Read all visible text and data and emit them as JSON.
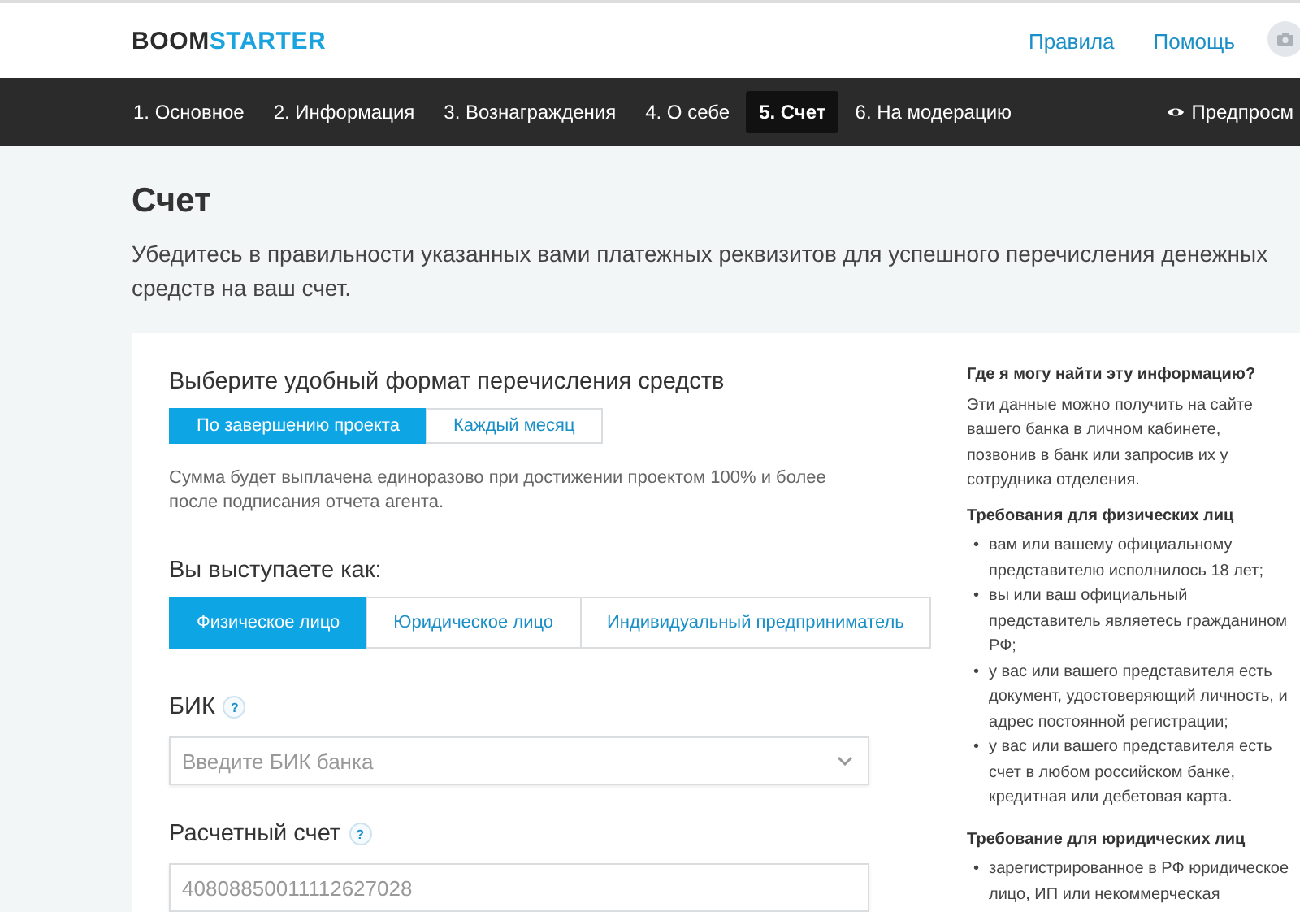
{
  "header": {
    "logo": {
      "dark": "BOOM",
      "accent": "STARTER"
    },
    "links": [
      "Правила",
      "Помощь"
    ]
  },
  "steps": [
    {
      "label": "1. Основное",
      "selected": false
    },
    {
      "label": "2. Информация",
      "selected": false
    },
    {
      "label": "3. Вознаграждения",
      "selected": false
    },
    {
      "label": "4. О себе",
      "selected": false
    },
    {
      "label": "5. Счет",
      "selected": true
    },
    {
      "label": "6. На модерацию",
      "selected": false
    }
  ],
  "preview": "Предпросм",
  "title": "Счет",
  "intro": "Убедитесь в правильности указанных вами платежных реквизитов для успешного перечисления денежных средств на ваш счет.",
  "payout": {
    "label": "Выберите удобный формат перечисления средств",
    "options": [
      {
        "label": "По завершению проекта",
        "selected": true
      },
      {
        "label": "Каждый месяц",
        "selected": false
      }
    ],
    "note": "Сумма будет выплачена единоразово при достижении проектом 100% и более после подписания отчета агента."
  },
  "role": {
    "label": "Вы выступаете как:",
    "options": [
      {
        "label": "Физическое лицо",
        "selected": true
      },
      {
        "label": "Юридическое лицо",
        "selected": false
      },
      {
        "label": "Индивидуальный предприниматель",
        "selected": false
      }
    ]
  },
  "fields": [
    {
      "kind": "select",
      "label": "БИК",
      "help": "?",
      "placeholder": "Введите БИК банка"
    },
    {
      "kind": "input",
      "label": "Расчетный счет",
      "help": "?",
      "placeholder": "40808850011112627028"
    }
  ],
  "aside": [
    {
      "heading": "Где я могу найти эту информацию?",
      "text": "Эти данные можно получить на сайте вашего банка в личном кабинете, позвонив в банк или запросив их у сотрудника отделения."
    },
    {
      "heading": "Требования для физических лиц",
      "bullet": "•",
      "items": [
        "вам или вашему официальному представителю исполнилось 18 лет;",
        "вы или ваш официальный представитель являетесь гражданином РФ;",
        "у вас или вашего представителя есть документ, удостоверяющий личность, и адрес постоянной регистрации;",
        "у вас или вашего представителя есть счет в любом российском банке, кредитная или дебетовая карта."
      ]
    },
    {
      "heading": "Требование для юридических лиц",
      "bullet": "•",
      "items": [
        "зарегистрированное в РФ юридическое лицо, ИП или некоммерческая"
      ]
    }
  ]
}
